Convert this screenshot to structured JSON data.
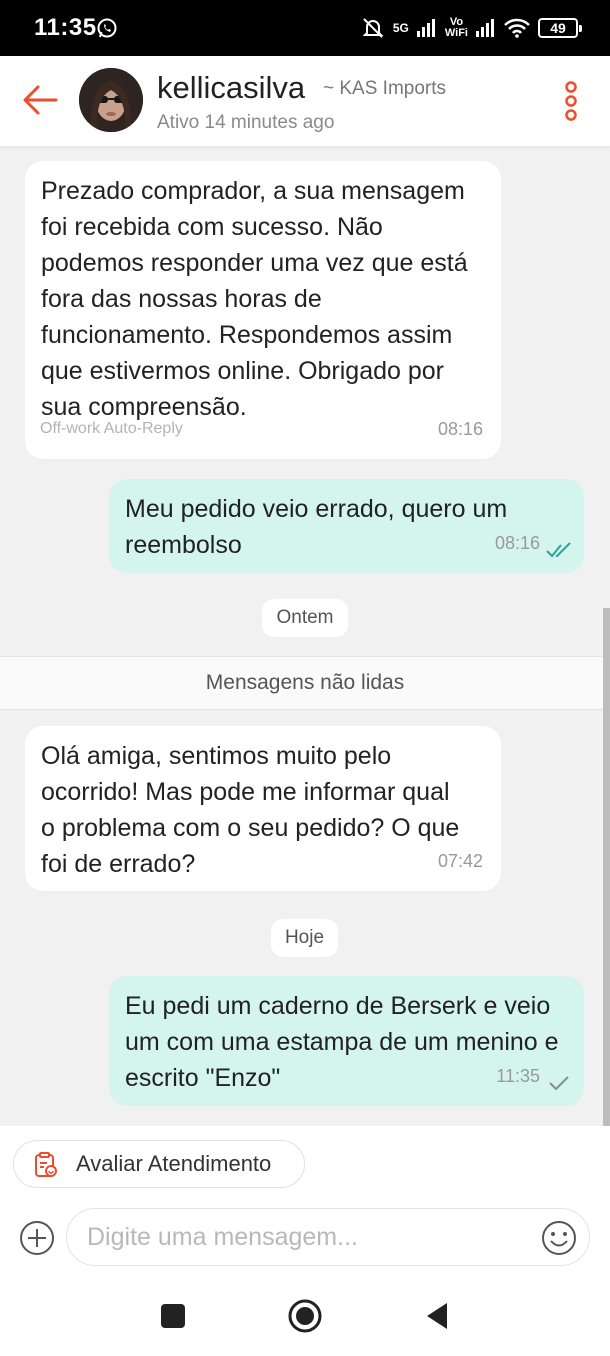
{
  "status_bar": {
    "time": "11:35",
    "network_5g": "5G",
    "vowifi": "Vo\nWiFi",
    "battery": "49"
  },
  "header": {
    "contact_name": "kellicasilva",
    "shop_name": "~ KAS Imports",
    "status": "Ativo 14 minutes ago",
    "accent_color": "#ee4d2d"
  },
  "messages": [
    {
      "direction": "incoming",
      "text": "Prezado comprador, a sua mensagem foi recebida com sucesso. Não podemos responder uma vez que está fora das nossas horas de funcionamento. Respondemos assim que estivermos online. Obrigado por sua compreensão.",
      "tag": "Off-work Auto-Reply",
      "time": "08:16"
    },
    {
      "direction": "outgoing",
      "text": "Meu pedido veio errado, quero um reembolso",
      "time": "08:16",
      "read_status": "read"
    },
    {
      "direction": "incoming",
      "text": "Olá amiga, sentimos muito pelo ocorrido! Mas pode me informar qual o problema com o seu pedido? O que foi de errado?",
      "time": "07:42"
    },
    {
      "direction": "outgoing",
      "text": "Eu pedi um caderno de Berserk e veio um com uma estampa de um menino e escrito \"Enzo\"",
      "time": "11:35",
      "read_status": "delivered"
    }
  ],
  "dividers": {
    "yesterday": "Ontem",
    "unread": "Mensagens não lidas",
    "today": "Hoje"
  },
  "bottom": {
    "rate_button": "Avaliar Atendimento",
    "input_placeholder": "Digite uma mensagem..."
  },
  "colors": {
    "outgoing_bubble": "#d4f5ee",
    "incoming_bubble": "#ffffff",
    "read_check": "#26a69a",
    "chat_background": "#f1f1f1"
  },
  "icons": {
    "back": "arrow-left-icon",
    "more": "three-dots-vertical-icon",
    "rate": "rating-form-icon",
    "plus": "plus-circle-icon",
    "emoji": "emoji-icon"
  }
}
